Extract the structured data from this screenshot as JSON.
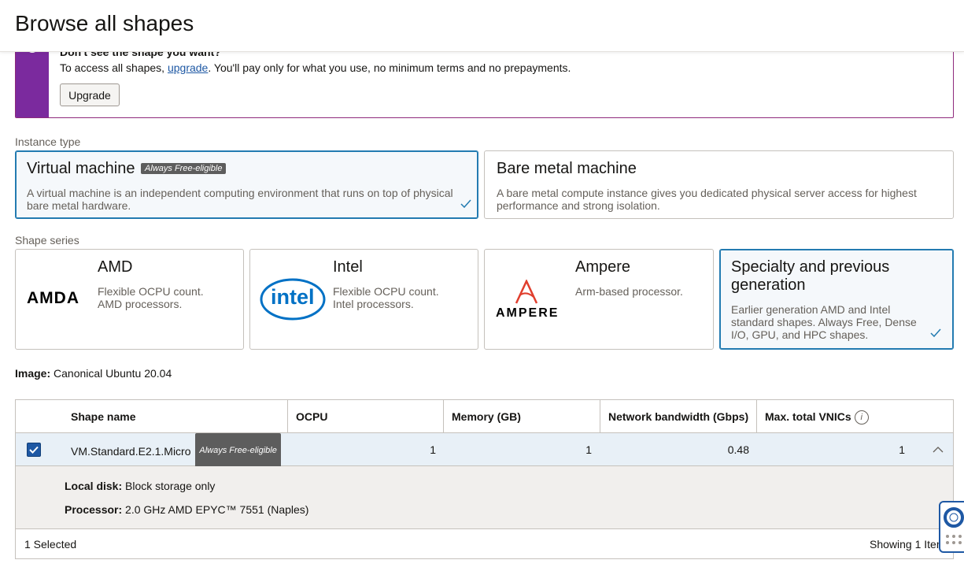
{
  "header": {
    "title": "Browse all shapes"
  },
  "banner": {
    "title": "Don't see the shape you want?",
    "text_before": "To access all shapes, ",
    "link": "upgrade",
    "text_after": ". You'll pay only for what you use, no minimum terms and no prepayments.",
    "button": "Upgrade"
  },
  "instance_type": {
    "label": "Instance type",
    "options": [
      {
        "title": "Virtual machine",
        "badge": "Always Free-eligible",
        "desc": "A virtual machine is an independent computing environment that runs on top of physical bare metal hardware.",
        "selected": true
      },
      {
        "title": "Bare metal machine",
        "desc": "A bare metal compute instance gives you dedicated physical server access for highest performance and strong isolation.",
        "selected": false
      }
    ]
  },
  "shape_series": {
    "label": "Shape series",
    "options": [
      {
        "title": "AMD",
        "desc": "Flexible OCPU count. AMD processors.",
        "logo": "AMDA",
        "selected": false
      },
      {
        "title": "Intel",
        "desc": "Flexible OCPU count. Intel processors.",
        "logo": "intel",
        "selected": false
      },
      {
        "title": "Ampere",
        "desc": "Arm-based processor.",
        "logo": "AMPERE",
        "selected": false
      },
      {
        "title": "Specialty and previous generation",
        "desc": "Earlier generation AMD and Intel standard shapes. Always Free, Dense I/O, GPU, and HPC shapes.",
        "selected": true
      }
    ]
  },
  "image": {
    "label": "Image:",
    "value": "Canonical Ubuntu 20.04"
  },
  "table": {
    "columns": [
      "Shape name",
      "OCPU",
      "Memory (GB)",
      "Network bandwidth (Gbps)",
      "Max. total VNICs"
    ],
    "rows": [
      {
        "name": "VM.Standard.E2.1.Micro",
        "badge": "Always Free-eligible",
        "ocpu": "1",
        "memory": "1",
        "bandwidth": "0.48",
        "vnics": "1",
        "checked": true
      }
    ],
    "detail": {
      "disk_label": "Local disk:",
      "disk_value": "Block storage only",
      "proc_label": "Processor:",
      "proc_value": "2.0 GHz AMD EPYC™ 7551 (Naples)"
    },
    "footer": {
      "selected": "1 Selected",
      "showing": "Showing 1 Iter"
    }
  },
  "colors": {
    "accent": "#237bb1",
    "banner": "#7b2a9e",
    "checkbox": "#1e58a4"
  }
}
